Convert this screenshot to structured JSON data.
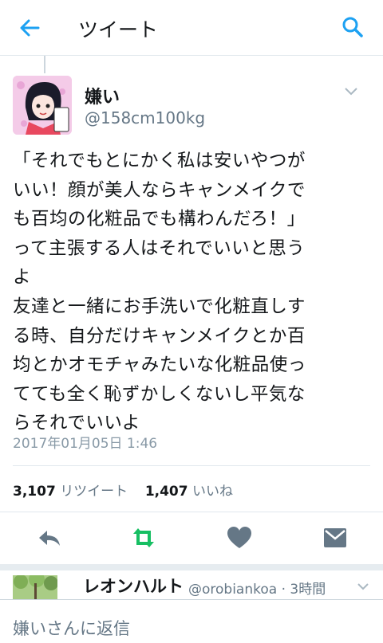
{
  "header": {
    "title": "ツイート",
    "back_icon": "arrow-left-icon",
    "search_icon": "search-icon"
  },
  "tweet": {
    "display_name": "嫌い",
    "handle": "@158cm100kg",
    "text": "「それでもとにかく私は安いやつが\nいい！顔が美人ならキャンメイクで\nも百均の化粧品でも構わんだろ！」\nって主張する人はそれでいいと思う\nよ\n友達と一緒にお手洗いで化粧直しす\nる時、自分だけキャンメイクとか百\n均とかオモチャみたいな化粧品使っ\nてても全く恥ずかしくないし平気な\nらそれでいいよ",
    "timestamp": "2017年01月05日 1:46",
    "retweets": "3,107",
    "retweets_label": "リツイート",
    "likes": "1,407",
    "likes_label": "いいね"
  },
  "actions": [
    "reply-icon",
    "retweet-icon",
    "heart-icon",
    "message-icon"
  ],
  "colors": {
    "accent": "#1da1f2",
    "retweet_green": "#17bf63",
    "icon_gray": "#657786"
  },
  "reply_preview": {
    "display_name": "レオンハルト",
    "meta": "@orobiankoa · 3時間"
  },
  "reply_bar": {
    "placeholder": "嫌いさんに返信"
  }
}
